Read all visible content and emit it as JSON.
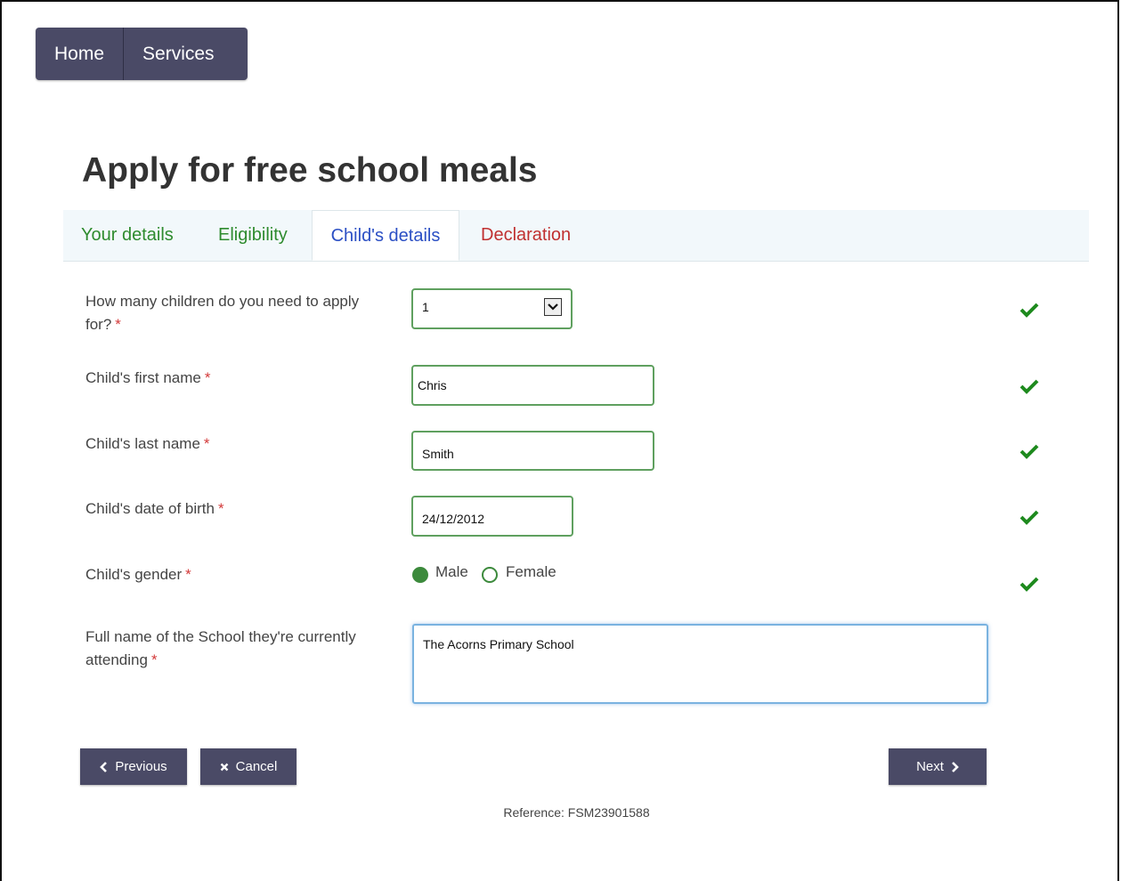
{
  "nav": {
    "items": [
      {
        "label": "Home"
      },
      {
        "label": "Services"
      }
    ]
  },
  "page": {
    "title": "Apply for free school meals"
  },
  "tabs": [
    {
      "label": "Your details",
      "state": "completed"
    },
    {
      "label": "Eligibility",
      "state": "completed"
    },
    {
      "label": "Child's details",
      "state": "active"
    },
    {
      "label": "Declaration",
      "state": "pending"
    }
  ],
  "form": {
    "required_marker": "*",
    "num_children": {
      "label": "How many children do you need to apply for?",
      "value": "1"
    },
    "first_name": {
      "label": "Child's first name",
      "value": "Chris"
    },
    "last_name": {
      "label": "Child's last name",
      "value": "Smith"
    },
    "dob": {
      "label": "Child's date of birth",
      "value": "24/12/2012"
    },
    "gender": {
      "label": "Child's gender",
      "options": [
        "Male",
        "Female"
      ],
      "selected": "Male"
    },
    "school": {
      "label": "Full name of the School they're currently attending",
      "value": "The Acorns Primary School"
    }
  },
  "buttons": {
    "previous": "Previous",
    "cancel": "Cancel",
    "next": "Next"
  },
  "footer": {
    "reference": "Reference: FSM23901588"
  },
  "colors": {
    "nav_bg": "#4a4a66",
    "valid_green": "#1e8a1e",
    "tab_active": "#2b4fc4",
    "tab_pending": "#c03030",
    "required_red": "#d33a3a"
  },
  "icons": {
    "valid": "checkmark-icon",
    "select": "chevron-down-icon",
    "previous": "chevron-left-icon",
    "cancel": "x-icon",
    "next": "chevron-right-icon"
  }
}
